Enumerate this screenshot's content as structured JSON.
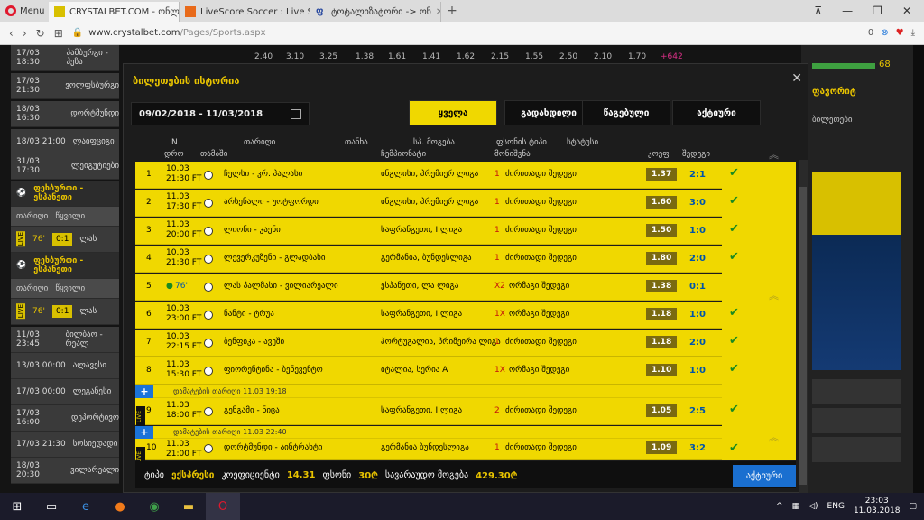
{
  "browser": {
    "menu_label": "Menu",
    "tabs": [
      {
        "title": "CRYSTALBET.COM - ონლა",
        "active": true
      },
      {
        "title": "LiveScore Soccer : Live Sco",
        "active": false
      },
      {
        "title": "ტოტალიზატორი -> ონ",
        "active": false
      }
    ],
    "new_tab": "+",
    "url_host": "www.crystalbet.com",
    "url_path": "/Pages/Sports.aspx",
    "badge_count": "0"
  },
  "background": {
    "top_odds": [
      "2.40",
      "3.10",
      "3.25",
      "1.38",
      "1.61",
      "1.41",
      "1.62",
      "2.15",
      "1.55",
      "2.50",
      "2.10",
      "1.70",
      "+642"
    ],
    "left_rows": [
      {
        "date": "17/03 18:30",
        "name": "პამბურგი - ჰეზა"
      },
      {
        "date": "17/03 21:30",
        "name": "ვოლფსბურგი"
      },
      {
        "date": "18/03 16:30",
        "name": "დორტმუნდი"
      },
      {
        "date": "18/03 21:00",
        "name": "ლაიფციგი"
      },
      {
        "date": "31/03 17:30",
        "name": "ლეიგუტიები"
      }
    ],
    "section1": "ფეხბურთი - ესპანეთი",
    "colhdr": {
      "a": "თარიღი",
      "b": "წყვილი"
    },
    "live1": {
      "minute": "76'",
      "score": "0:1",
      "name": "ლას"
    },
    "section2": "ფეხბურთი - ესპანეთი",
    "live2": {
      "minute": "76'",
      "score": "0:1",
      "name": "ლას"
    },
    "left_rows2": [
      {
        "date": "11/03 23:45",
        "name": "ბილბაო - რეალ"
      },
      {
        "date": "13/03 00:00",
        "name": "ალავესი"
      },
      {
        "date": "17/03 00:00",
        "name": "ლეგანესი"
      },
      {
        "date": "17/03 16:00",
        "name": "დეპორტივო"
      },
      {
        "date": "17/03 21:30",
        "name": "სოსიედადი"
      },
      {
        "date": "18/03 20:30",
        "name": "ვილარეალი"
      }
    ],
    "right_panel": {
      "count": "68",
      "title": "ფავორიტ",
      "subtitle": "ბილეთები"
    }
  },
  "modal": {
    "title": "ბილეთების ისტორია",
    "close": "✕",
    "date_range": "09/02/2018 - 11/03/2018",
    "filters": [
      "ყველა",
      "გადახდილი",
      "წაგებული",
      "აქტიური"
    ],
    "active_filter": 0,
    "columns": [
      "N",
      "თარიღი",
      "თანხა",
      "სპ. მოგება",
      "ფსონის ტიპი",
      "სტატუსი"
    ],
    "subcolumns": {
      "time": "დრო",
      "match": "თამაში",
      "event": "ჩემპიონატი",
      "market": "მონიშვნა",
      "coef": "კოეფ",
      "result": "შედეგი"
    },
    "rows": [
      {
        "n": "1",
        "date": "10.03",
        "time": "21:30 FT",
        "match": "ჩელსი - კრ. პალასი",
        "league": "ინგლისი, პრემიერ ლიგა",
        "pick_num": "1",
        "pick": "ძირითადი შედეგი",
        "odd": "1.37",
        "score": "2:1"
      },
      {
        "n": "2",
        "date": "11.03",
        "time": "17:30 FT",
        "match": "არსენალი - უოტფორდი",
        "league": "ინგლისი, პრემიერ ლიგა",
        "pick_num": "1",
        "pick": "ძირითადი შედეგი",
        "odd": "1.60",
        "score": "3:0"
      },
      {
        "n": "3",
        "date": "11.03",
        "time": "20:00 FT",
        "match": "ლიონი - კაენი",
        "league": "საფრანგეთი, I ლიგა",
        "pick_num": "1",
        "pick": "ძირითადი შედეგი",
        "odd": "1.50",
        "score": "1:0"
      },
      {
        "n": "4",
        "date": "10.03",
        "time": "21:30 FT",
        "match": "ლევერკუზენი - გლადბახი",
        "league": "გერმანია, ბუნდესლიგა",
        "pick_num": "1",
        "pick": "ძირითადი შედეგი",
        "odd": "1.80",
        "score": "2:0"
      },
      {
        "n": "5",
        "date": "",
        "time": "76'",
        "match": "ლას პალმასი - ვილიარეალი",
        "league": "ესპანეთი, ლა ლიგა",
        "pick_num": "X2",
        "pick": "ორმაგი შედეგი",
        "odd": "1.38",
        "score": "0:1"
      },
      {
        "n": "6",
        "date": "10.03",
        "time": "23:00 FT",
        "match": "ნანტი - ტრუა",
        "league": "საფრანგეთი, I ლიგა",
        "pick_num": "1X",
        "pick": "ორმაგი შედეგი",
        "odd": "1.18",
        "score": "1:0"
      },
      {
        "n": "7",
        "date": "10.03",
        "time": "22:15 FT",
        "match": "ბენფიკა - ავეში",
        "league": "პორტუგალია, პრიმეირა ლიგა",
        "pick_num": "1",
        "pick": "ძირითადი შედეგი",
        "odd": "1.18",
        "score": "2:0"
      },
      {
        "n": "8",
        "date": "11.03",
        "time": "15:30 FT",
        "match": "ფიორენტინა - ბენევენტო",
        "league": "იტალია, სერია A",
        "pick_num": "1X",
        "pick": "ორმაგი შედეგი",
        "odd": "1.10",
        "score": "1:0"
      },
      {
        "n": "9",
        "date": "11.03",
        "time": "18:00 FT",
        "match": "გენგამი - ნიცა",
        "league": "საფრანგეთი, I ლიგა",
        "pick_num": "2",
        "pick": "ძირითადი შედეგი",
        "odd": "1.05",
        "score": "2:5",
        "info": "დამატების თარიღი 11.03 19:18"
      },
      {
        "n": "10",
        "date": "11.03",
        "time": "21:00 FT",
        "match": "დორტმუნდი - აინტრახტი",
        "league": "გერმანია ბუნდესლიგა",
        "pick_num": "1",
        "pick": "ძირითადი შედეგი",
        "odd": "1.09",
        "score": "3:2",
        "info": "დამატების თარიღი 11.03 22:40"
      }
    ],
    "summary": {
      "type_label": "ტიპი",
      "type_value": "ექსპრესი",
      "coef_label": "კოეფიციენტი",
      "coef_value": "14.31",
      "stake_label": "ფსონი",
      "stake_value": "30₾",
      "win_label": "სავარაუდო მოგება",
      "win_value": "429.30₾",
      "button": "აქტიური"
    }
  },
  "taskbar": {
    "lang": "ENG",
    "time": "23:03",
    "date": "11.03.2018"
  }
}
